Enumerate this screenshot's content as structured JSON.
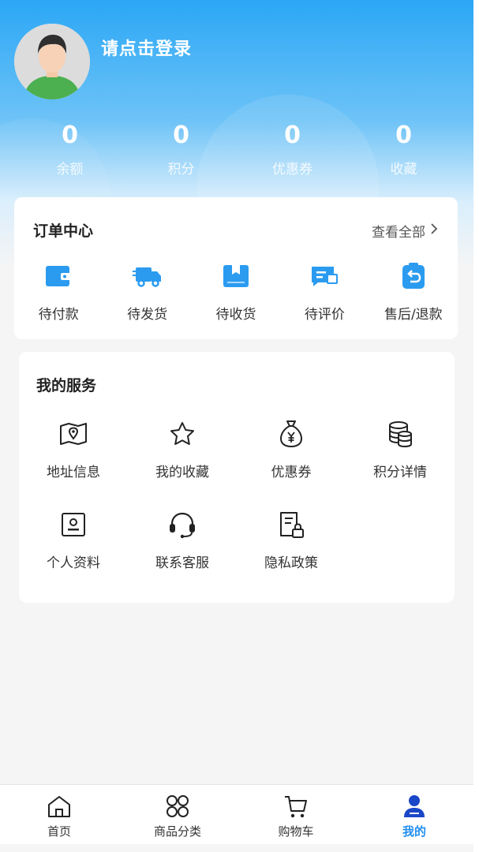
{
  "profile": {
    "login_prompt": "请点击登录",
    "avatar_icon": "user-avatar-icon"
  },
  "stats": [
    {
      "value": "0",
      "label": "余额"
    },
    {
      "value": "0",
      "label": "积分"
    },
    {
      "value": "0",
      "label": "优惠券"
    },
    {
      "value": "0",
      "label": "收藏"
    }
  ],
  "orders": {
    "title": "订单中心",
    "view_all": "查看全部",
    "items": [
      {
        "label": "待付款",
        "icon": "wallet-icon"
      },
      {
        "label": "待发货",
        "icon": "delivery-truck-icon"
      },
      {
        "label": "待收货",
        "icon": "package-icon"
      },
      {
        "label": "待评价",
        "icon": "review-icon"
      },
      {
        "label": "售后/退款",
        "icon": "refund-icon"
      }
    ]
  },
  "services": {
    "title": "我的服务",
    "items": [
      {
        "label": "地址信息",
        "icon": "map-pin-icon"
      },
      {
        "label": "我的收藏",
        "icon": "star-icon"
      },
      {
        "label": "优惠券",
        "icon": "money-bag-icon"
      },
      {
        "label": "积分详情",
        "icon": "coins-stack-icon"
      },
      {
        "label": "个人资料",
        "icon": "id-card-icon"
      },
      {
        "label": "联系客服",
        "icon": "headset-icon"
      },
      {
        "label": "隐私政策",
        "icon": "document-lock-icon"
      }
    ]
  },
  "tabbar": {
    "items": [
      {
        "label": "首页",
        "icon": "home-icon"
      },
      {
        "label": "商品分类",
        "icon": "category-grid-icon"
      },
      {
        "label": "购物车",
        "icon": "cart-icon"
      },
      {
        "label": "我的",
        "icon": "user-icon"
      }
    ],
    "active_index": 3
  },
  "colors": {
    "accent": "#1f8ef0",
    "header_top": "#2ba7f5",
    "order_icon": "#2b9bf0",
    "background": "#f5f5f5"
  }
}
